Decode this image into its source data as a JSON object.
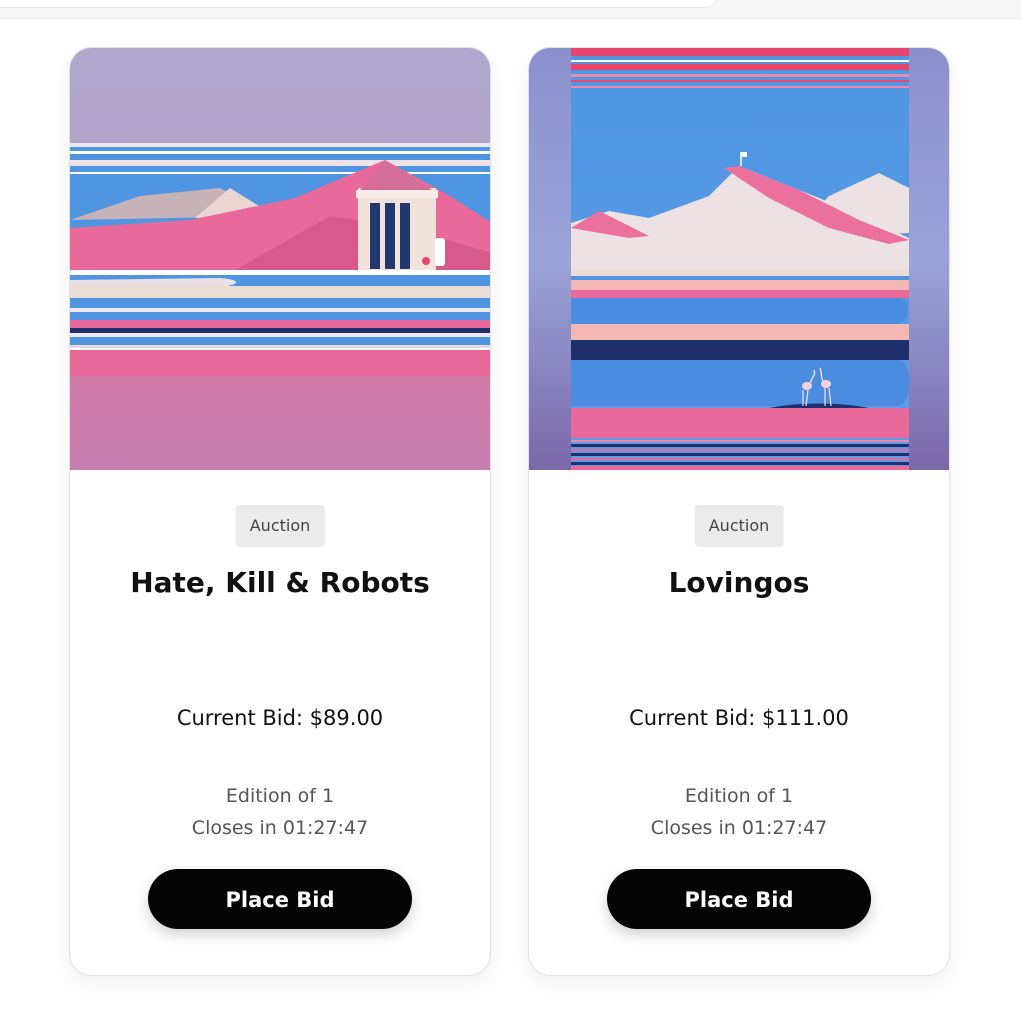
{
  "cards": [
    {
      "badge": "Auction",
      "title": "Hate, Kill & Robots",
      "current_bid": "Current Bid: $89.00",
      "edition": "Edition of 1",
      "closes": "Closes in 01:27:47",
      "button_label": "Place Bid"
    },
    {
      "badge": "Auction",
      "title": "Lovingos",
      "current_bid": "Current Bid: $111.00",
      "edition": "Edition of 1",
      "closes": "Closes in 01:27:47",
      "button_label": "Place Bid"
    }
  ],
  "colors": {
    "pink": "#e96a9a",
    "blue": "#4f95e2",
    "navy": "#1f2f6b",
    "lavender": "#b2a6cc",
    "cream": "#ecdcd8",
    "button": "#050505"
  }
}
